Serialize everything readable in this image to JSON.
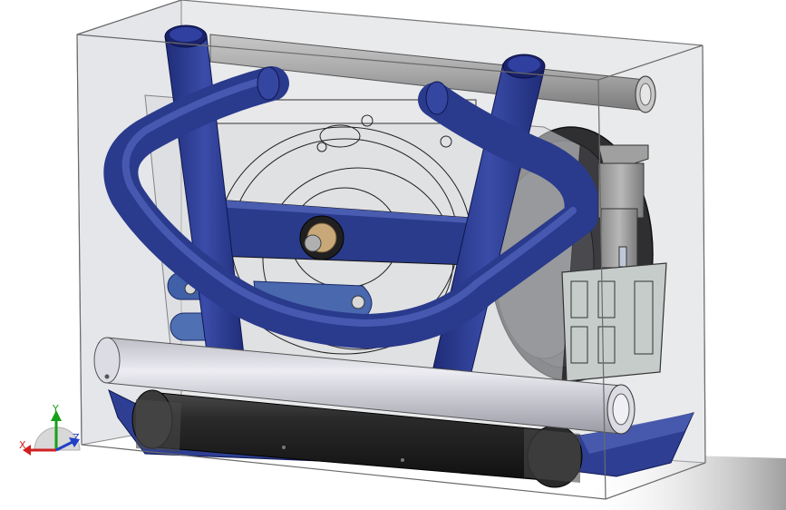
{
  "viewport": {
    "background": "#ffffff",
    "model": {
      "frame_color": "#2a3c8f",
      "pipe_color": "#2e3f93",
      "bar_color": "#d4d4dc",
      "roller_color": "#2e2e2e",
      "bracket_color": "#c5ccca",
      "enclosure_edge_color": "#6a6a6a"
    }
  },
  "triad": {
    "x_label": "X",
    "y_label": "Y",
    "z_label": "Z",
    "x_color": "#d02020",
    "y_color": "#18a018",
    "z_color": "#2040c8"
  }
}
